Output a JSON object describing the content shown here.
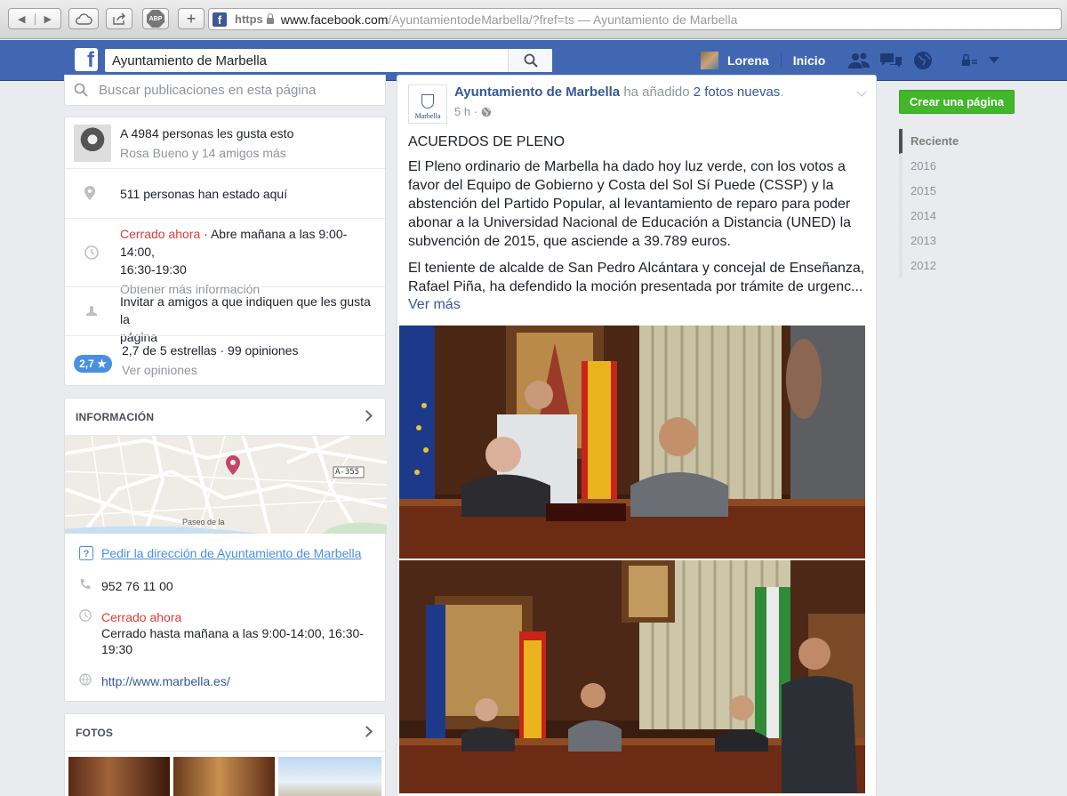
{
  "browser": {
    "url_scheme": "https",
    "url_host": "www.facebook.com",
    "url_path": "/AyuntamientodeMarbella/?fref=ts",
    "page_title": "— Ayuntamiento de Marbella",
    "adblock_label": "ABP",
    "icons": [
      "back-icon",
      "forward-icon",
      "cloud-icon",
      "share-icon",
      "adblock-icon",
      "new-tab-icon",
      "lock-icon"
    ]
  },
  "topbar": {
    "search_value": "Ayuntamiento de Marbella",
    "user_name": "Lorena",
    "home_label": "Inicio",
    "brand_color": "#4267b2"
  },
  "left": {
    "page_search_placeholder": "Buscar publicaciones en esta página",
    "likes": {
      "title": "A 4984 personas les gusta esto",
      "friends": "Rosa Bueno y 14 amigos más"
    },
    "visits": "511 personas han estado aquí",
    "hours": {
      "status": "Cerrado ahora",
      "detail": " · Abre mañana a las 9:00-14:00,",
      "detail2": "16:30-19:30",
      "more": "Obtener más información"
    },
    "invite": {
      "line1": "Invitar a amigos a que indiquen que les gusta la",
      "line2": "página"
    },
    "rating": {
      "badge": "2,7 ★",
      "summary": "2,7 de 5 estrellas · 99 opiniones",
      "link": "Ver opiniones"
    },
    "info": {
      "heading": "INFORMACIÓN",
      "map_road": "A-355",
      "map_street_1": "Paseo de la",
      "directions": "Pedir la dirección de Ayuntamiento de Marbella",
      "phone": "952 76 11 00",
      "closed": "Cerrado ahora",
      "closed_detail": "Cerrado hasta mañana a las 9:00-14:00, 16:30-19:30",
      "website": "http://www.marbella.es/"
    },
    "photos_heading": "FOTOS"
  },
  "post": {
    "page_name": "Ayuntamiento de Marbella",
    "logo_text": "Marbella",
    "action": " ha añadido ",
    "photos_link": "2 fotos nuevas",
    "action_end": ".",
    "time": "5 h ·",
    "title": "ACUERDOS DE PLENO",
    "para1": "El Pleno ordinario de Marbella ha dado hoy luz verde, con los votos a favor del Equipo de Gobierno y Costa del Sol Sí Puede (CSSP) y la abstención del Partido Popular, al levantamiento de reparo para poder abonar a la Universidad Nacional de Educación a Distancia (UNED) la subvención de 2015, que asciende a 39.789 euros.",
    "para2": "El teniente de alcalde de San Pedro Alcántara y concejal de Enseñanza, Rafael Piña, ha defendido la moción presentada por trámite de urgenc...",
    "see_more": "Ver más"
  },
  "right": {
    "create_page": "Crear una página",
    "timeline": [
      "Reciente",
      "2016",
      "2015",
      "2014",
      "2013",
      "2012"
    ]
  }
}
